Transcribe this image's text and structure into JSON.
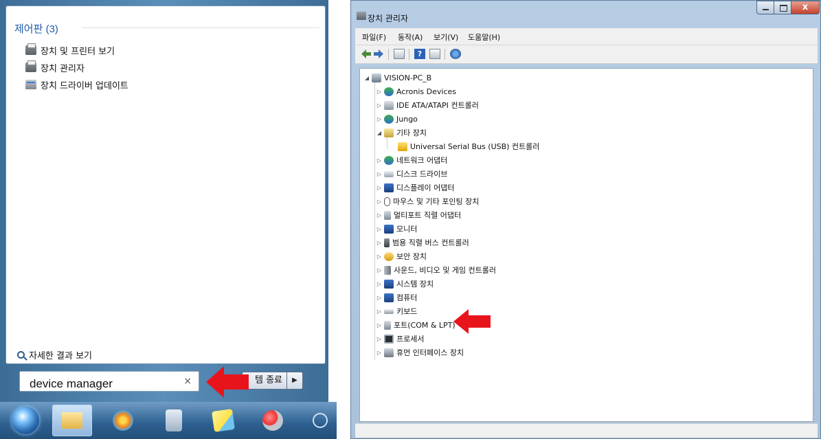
{
  "start_menu": {
    "category_heading": "제어판 (3)",
    "results": [
      {
        "label": "장치 및 프린터 보기",
        "icon": "printer-icon"
      },
      {
        "label": "장치 관리자",
        "icon": "printer-icon"
      },
      {
        "label": "장치 드라이버 업데이트",
        "icon": "driver-icon"
      }
    ],
    "more_results": "자세한 결과 보기",
    "search_value": "device manager",
    "clear_symbol": "×",
    "shutdown_label": "템 종료",
    "shutdown_arrow": "▶"
  },
  "device_manager": {
    "title": "장치 관리자",
    "close_symbol": "x",
    "menu": [
      "파일(F)",
      "동작(A)",
      "보기(V)",
      "도움말(H)"
    ],
    "tree": {
      "root": "VISION-PC_B",
      "nodes": [
        {
          "label": "Acronis Devices",
          "icon": "network-icon",
          "expanded": false
        },
        {
          "label": "IDE ATA/ATAPI 컨트롤러",
          "icon": "disk-controller-icon",
          "expanded": false
        },
        {
          "label": "Jungo",
          "icon": "network-icon",
          "expanded": false
        },
        {
          "label": "기타 장치",
          "icon": "unknown-device-icon",
          "expanded": true
        },
        {
          "label": "Universal Serial Bus (USB) 컨트롤러",
          "icon": "warning-device-icon",
          "child": true
        },
        {
          "label": "네트워크 어댑터",
          "icon": "network-icon",
          "expanded": false
        },
        {
          "label": "디스크 드라이브",
          "icon": "disk-icon",
          "expanded": false
        },
        {
          "label": "디스플레이 어댑터",
          "icon": "display-icon",
          "expanded": false
        },
        {
          "label": "마우스 및 기타 포인팅 장치",
          "icon": "mouse-icon",
          "expanded": false
        },
        {
          "label": "멀티포트 직렬 어댑터",
          "icon": "port-icon",
          "expanded": false
        },
        {
          "label": "모니터",
          "icon": "monitor-icon",
          "expanded": false
        },
        {
          "label": "범용 직렬 버스 컨트롤러",
          "icon": "usb-icon",
          "expanded": false
        },
        {
          "label": "보안 장치",
          "icon": "key-icon",
          "expanded": false
        },
        {
          "label": "사운드, 비디오 및 게임 컨트롤러",
          "icon": "speaker-icon",
          "expanded": false
        },
        {
          "label": "시스템 장치",
          "icon": "system-icon",
          "expanded": false
        },
        {
          "label": "컴퓨터",
          "icon": "computer-icon",
          "expanded": false
        },
        {
          "label": "키보드",
          "icon": "keyboard-icon",
          "expanded": false
        },
        {
          "label": "포트(COM & LPT)",
          "icon": "port-icon",
          "expanded": false
        },
        {
          "label": "프로세서",
          "icon": "processor-icon",
          "expanded": false
        },
        {
          "label": "휴먼 인터페이스 장치",
          "icon": "hid-icon",
          "expanded": false
        }
      ]
    }
  },
  "colors": {
    "arrow": "#e8141c",
    "heading_blue": "#1e5ca8",
    "taskbar": "#2c5f8f"
  }
}
